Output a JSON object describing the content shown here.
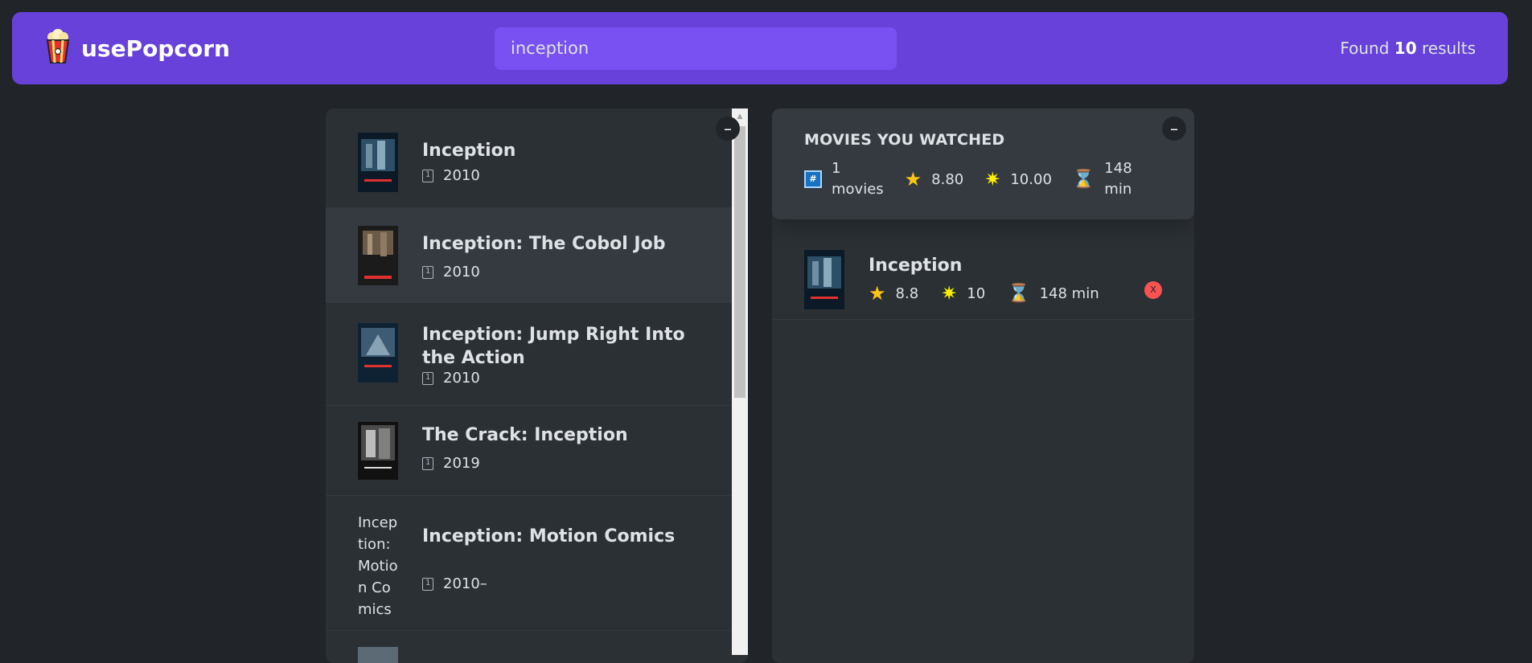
{
  "nav": {
    "logo_name": "usePopcorn",
    "search_value": "inception",
    "results_prefix": "Found",
    "results_count": "10",
    "results_suffix": "results"
  },
  "toggle_label": "–",
  "movies": [
    {
      "title": "Inception",
      "year": "2010"
    },
    {
      "title": "Inception: The Cobol Job",
      "year": "2010"
    },
    {
      "title": "Inception: Jump Right Into the Action",
      "year": "2010"
    },
    {
      "title": "The Crack: Inception",
      "year": "2019"
    },
    {
      "title": "Inception: Motion Comics",
      "year": "2010–",
      "poster_alt": "Inception: Motion Comics poster"
    }
  ],
  "summary": {
    "title": "MOVIES YOU WATCHED",
    "movies_count": "1",
    "movies_label": "movies",
    "avg_imdb": "8.80",
    "avg_user": "10.00",
    "runtime_value": "148",
    "runtime_unit": "min"
  },
  "watched": [
    {
      "title": "Inception",
      "imdb": "8.8",
      "user": "10",
      "runtime": "148 min",
      "delete_label": "X"
    }
  ],
  "icons": {
    "calendar": "calendar-icon",
    "hash": "hash-icon",
    "star": "star-icon",
    "user_star": "user-star-icon",
    "hourglass": "hourglass-icon"
  },
  "colors": {
    "background": "#212529",
    "nav": "#6741d9",
    "search": "#7950f2",
    "box": "#2b3035",
    "summary": "#343a40",
    "delete": "#fa5252"
  }
}
